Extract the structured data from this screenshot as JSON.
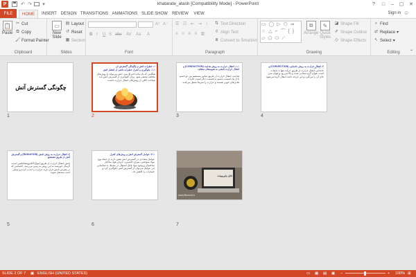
{
  "window": {
    "title": "khatarate_atash [Compatibility Mode] - PowerPoint",
    "app_icon": "P"
  },
  "quick_access": {
    "save": "save-icon",
    "undo": "undo-icon",
    "redo": "redo-icon",
    "start": "slideshow-start-icon",
    "customize": "customize-icon"
  },
  "window_controls": {
    "help": "?",
    "restore": "□",
    "minimize": "–",
    "maximize": "▢",
    "close": "✕"
  },
  "tabs": {
    "file": "FILE",
    "items": [
      "HOME",
      "INSERT",
      "DESIGN",
      "TRANSITIONS",
      "ANIMATIONS",
      "SLIDE SHOW",
      "REVIEW",
      "VIEW"
    ],
    "active": "HOME",
    "sign_in": "Sign in"
  },
  "ribbon": {
    "clipboard": {
      "label": "Clipboard",
      "paste": "Paste",
      "cut": "Cut",
      "copy": "Copy",
      "format_painter": "Format Painter"
    },
    "slides": {
      "label": "Slides",
      "new_slide": "New Slide",
      "layout": "Layout",
      "reset": "Reset",
      "section": "Section"
    },
    "font": {
      "label": "Font"
    },
    "paragraph": {
      "label": "Paragraph",
      "text_direction": "Text Direction",
      "align_text": "Align Text",
      "convert_smartart": "Convert to SmartArt"
    },
    "drawing": {
      "label": "Drawing",
      "arrange": "Arrange",
      "quick_styles": "Quick Styles",
      "shape_fill": "Shape Fill",
      "shape_outline": "Shape Outline",
      "shape_effects": "Shape Effects",
      "shapes_gallery": "▭ ◯ ▷ ⬡ ⇒ ☆ △ ⌐ ⌒ { } ▱ ⬠ ⬭ ⟋"
    },
    "editing": {
      "label": "Editing",
      "find": "Find",
      "replace": "Replace",
      "select": "Select"
    }
  },
  "slides": [
    {
      "number": "1",
      "selected": false,
      "title": "چگونگی گسترش آتش"
    },
    {
      "number": "2",
      "selected": true,
      "title": "۱- خطرات آتش و چگونگی گسترش آن",
      "subtitle": "۱-۱- جلوگیری و کنترل خطرات ناشی از انتشار آتش",
      "body": "هنگامی که یک ماده احتراق شد، آتش می‌تواند با روش‌های مختلف منتشر شود. برای جلوگیری از گسترش آتش باید شناخت کافی از روش‌های انتقال حرارت داشت."
    },
    {
      "number": "3",
      "selected": false,
      "title": "۱-۱- انتقال حرارت به روش هدایت (CONDUCTION) و انتقال حرارت تابشی به شیوه‌های مختلف",
      "body": "هدایت، انتقال حرارت از طریق تماس مستقیم بین دو جسم یا از یک قسمت جسم به قسمت دیگر است. فلزات هادی‌های خوبی هستند و حرارت را سریعاً منتقل می‌کنند."
    },
    {
      "number": "4",
      "selected": false,
      "title": "۲- انتقال حرارت به روش جابجایی (CONVECTION) و انتقال (B)",
      "body": "جابجایی انتقال حرارت از طریق حرکت هوا یا مایعات است. هوای گرم سبک‌تر شده و بالا می‌رود و هوای سرد جای آن را می‌گیرد و این چرخه باعث انتقال گرما می‌شود."
    },
    {
      "number": "5",
      "selected": false,
      "title": "۳- انتقال حرارت به روش تابش (RADIATION) و گسترش آتش از طریق تشعشع",
      "body": "تابش انتقال حرارت از طریق امواج الکترومغناطیس است. گرمای خورشید به این روش به زمین می‌رسد. اجسامی که در معرض تابش قرار دارند حرارت را جذب کرده و ممکن است مشتعل شوند."
    },
    {
      "number": "6",
      "selected": false,
      "title": "۴-۱- عوامل گسترش آتش و روش‌های کنترل",
      "body": "عوامل متعددی در گسترش آتش نقش دارند از جمله نوع مواد سوختنی، میزان اکسیژن، جریان هوا، ساختار ساختمان و وجود مواد قابل اشتعال در محیط. با شناسایی این عوامل می‌توان از گسترش آتش جلوگیری کرد و خسارات را کاهش داد."
    },
    {
      "number": "7",
      "selected": false,
      "title": "فایل پاورپوینت",
      "caption": "www.fileword.ir"
    }
  ],
  "status": {
    "slide": "SLIDE 2 OF 7",
    "language": "ENGLISH (UNITED STATES)",
    "zoom": "100%",
    "zoom_minus": "−",
    "zoom_plus": "+"
  },
  "colors": {
    "accent": "#d24726",
    "slide_title": "#2e3a9c"
  }
}
